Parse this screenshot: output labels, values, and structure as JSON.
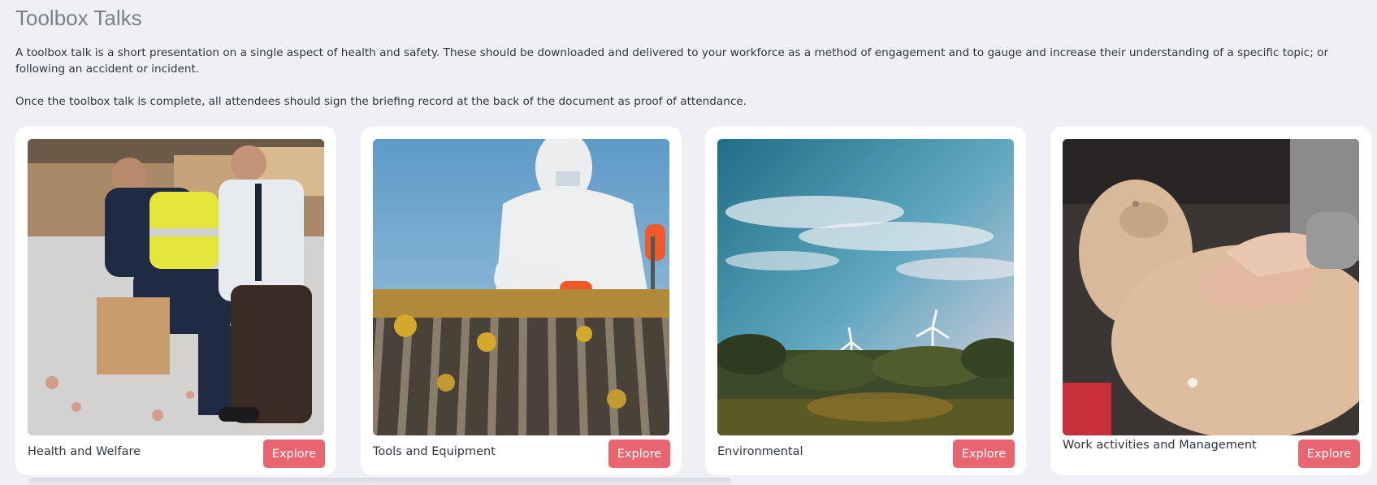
{
  "page": {
    "title": "Toolbox Talks",
    "intro": "A toolbox talk is a short presentation on a single aspect of health and safety. These should be downloaded and delivered to your workforce as a method of engagement and to gauge and increase their understanding of a specific topic; or following an accident or incident.",
    "instructions": "Once the toolbox talk is complete, all attendees should sign the briefing record at the back of the document as proof of attendance."
  },
  "cards": [
    {
      "label": "Health and Welfare",
      "button": "Explore",
      "image": "warehouse-lifting-photo"
    },
    {
      "label": "Tools and Equipment",
      "button": "Explore",
      "image": "roof-worker-photo"
    },
    {
      "label": "Environmental",
      "button": "Explore",
      "image": "wind-turbines-photo"
    },
    {
      "label": "Work activities and Management",
      "button": "Explore",
      "image": "cpr-training-photo"
    }
  ],
  "colors": {
    "background": "#eef0f5",
    "card": "#ffffff",
    "button": "#e9656f",
    "text": "#2f3640",
    "title": "#7b8088"
  }
}
